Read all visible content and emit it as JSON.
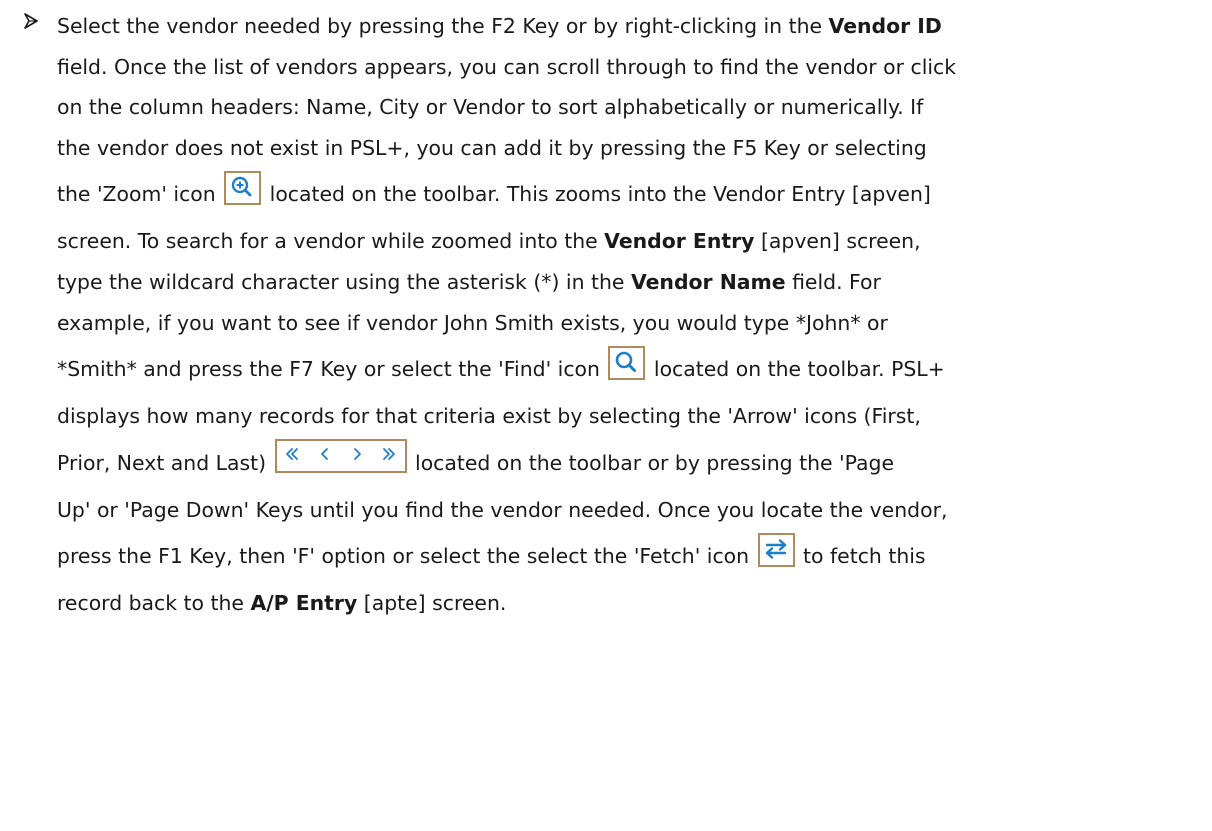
{
  "bullet_icon": "arrow-bullet-icon",
  "colors": {
    "text": "#1a1a1a",
    "icon_frame": "#b08a5c",
    "icon_blue": "#1e7fc9"
  },
  "toolbar_icons": {
    "zoom": "zoom-icon",
    "find": "find-icon",
    "arrows": [
      "first-icon",
      "prior-icon",
      "next-icon",
      "last-icon"
    ],
    "fetch": "fetch-icon"
  },
  "text": {
    "l1a": "Select the vendor needed by pressing the F2 Key or by right-clicking in the ",
    "l1b": "Vendor ID",
    "l2": "field. Once the list of vendors appears, you can scroll through to find the vendor or click",
    "l3": "on the column headers: Name, City or Vendor to sort alphabetically or numerically.  If",
    "l4": "the vendor does not exist in PSL+, you can add it by pressing the F5 Key or selecting",
    "l5a": "the 'Zoom' icon ",
    "l5b": " located on the toolbar. This zooms into the Vendor Entry [apven]",
    "l6": "screen.  To search for a vendor while zoomed into the ",
    "l6b": "Vendor Entry",
    "l6c": " [apven] screen,",
    "l7a": "type the wildcard character using the asterisk (*) in the ",
    "l7b": "Vendor Name",
    "l7c": " field.  For",
    "l8": "example, if you want to see if vendor John Smith exists, you would type *John* or",
    "l9a": "*Smith* and press the F7 Key or select the 'Find' icon ",
    "l9b": " located on the toolbar.  PSL+",
    "l10": "displays how many records for that criteria exist by selecting the 'Arrow' icons (First,",
    "l11a": "Prior, Next and Last) ",
    "l11b": " located on the toolbar or by pressing the 'Page",
    "l12": "Up' or 'Page Down' Keys until you find the vendor needed. Once you locate the vendor,",
    "l13a": "press the F1 Key, then 'F' option or select the select the 'Fetch' icon ",
    "l13b": " to fetch this",
    "l14a": "record back to the ",
    "l14b": "A/P Entry",
    "l14c": " [apte] screen."
  }
}
